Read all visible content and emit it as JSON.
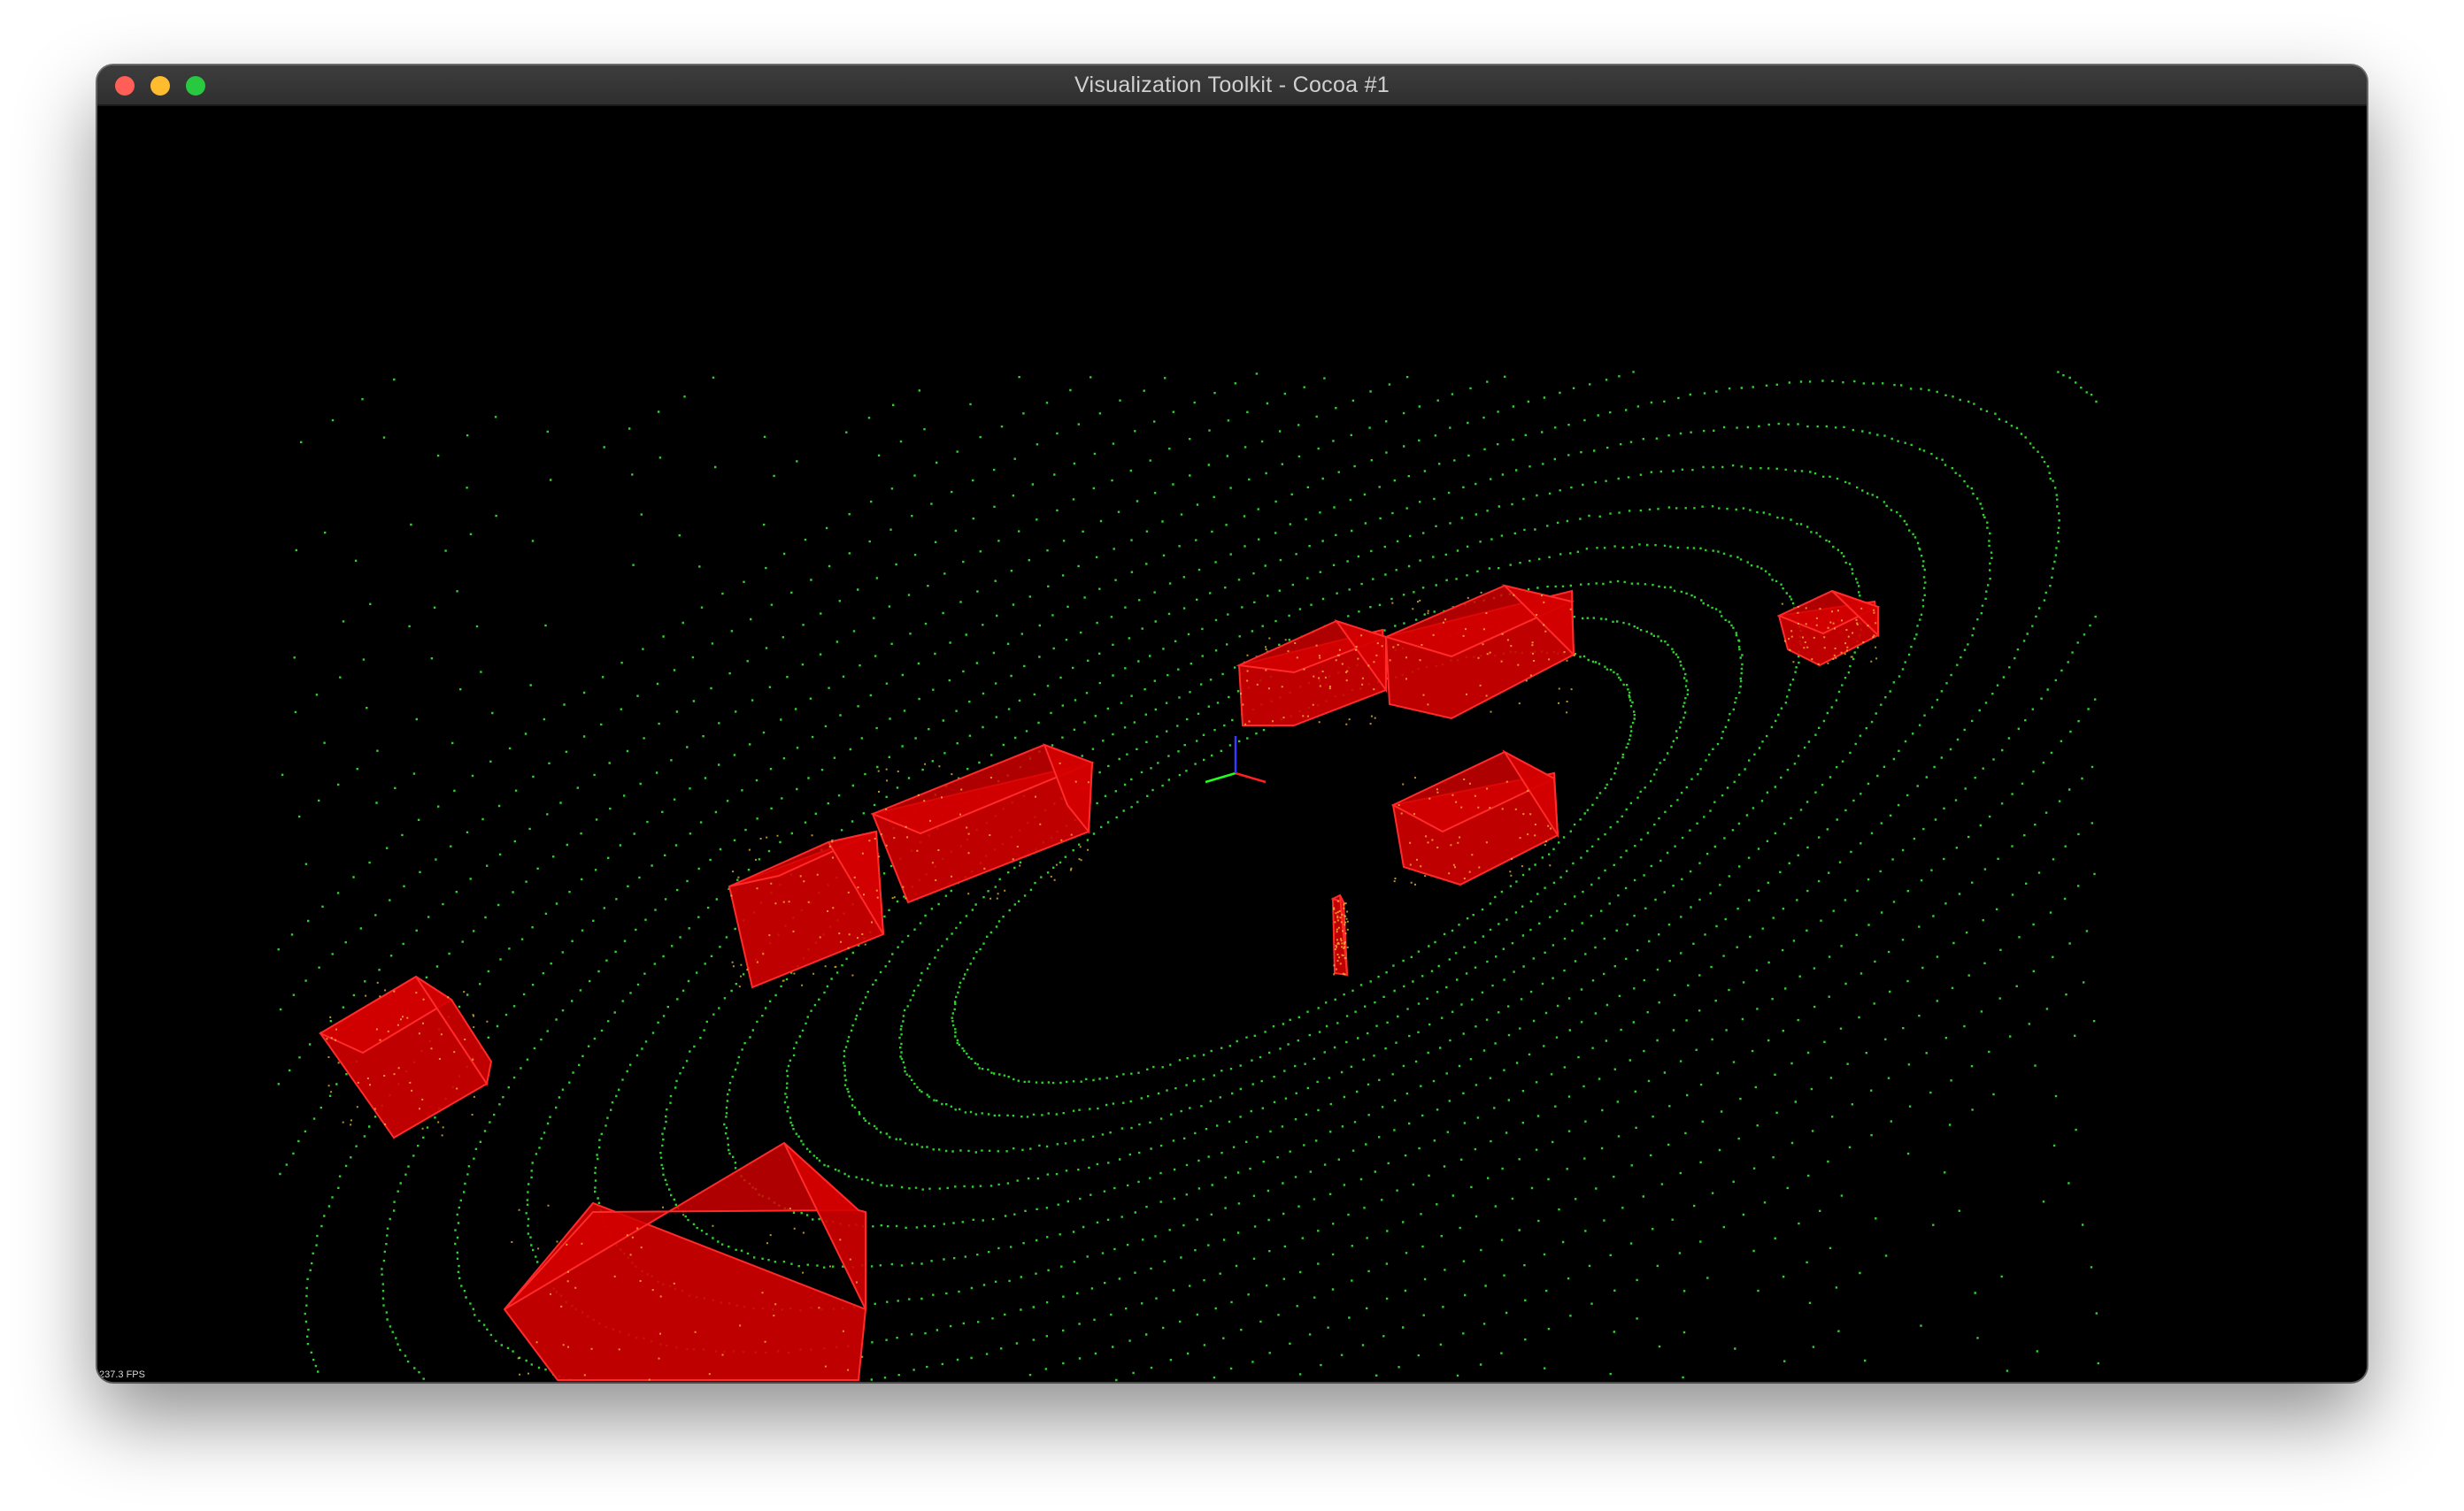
{
  "window": {
    "title": "Visualization Toolkit - Cocoa #1",
    "traffic_lights": [
      {
        "name": "close",
        "color": "#ff5f57"
      },
      {
        "name": "minimize",
        "color": "#febc2e"
      },
      {
        "name": "zoom",
        "color": "#28c840"
      }
    ]
  },
  "viewport": {
    "background": "#000000",
    "point_color": "#2fd12f",
    "box_color": "#d40000",
    "box_edge_color": "#ff2a2a",
    "highlight_color": "#ffd23a",
    "axes_colors": {
      "x": "#ff2020",
      "y": "#20ff20",
      "z": "#3a3aff"
    },
    "fps_text": "237.3 FPS"
  }
}
